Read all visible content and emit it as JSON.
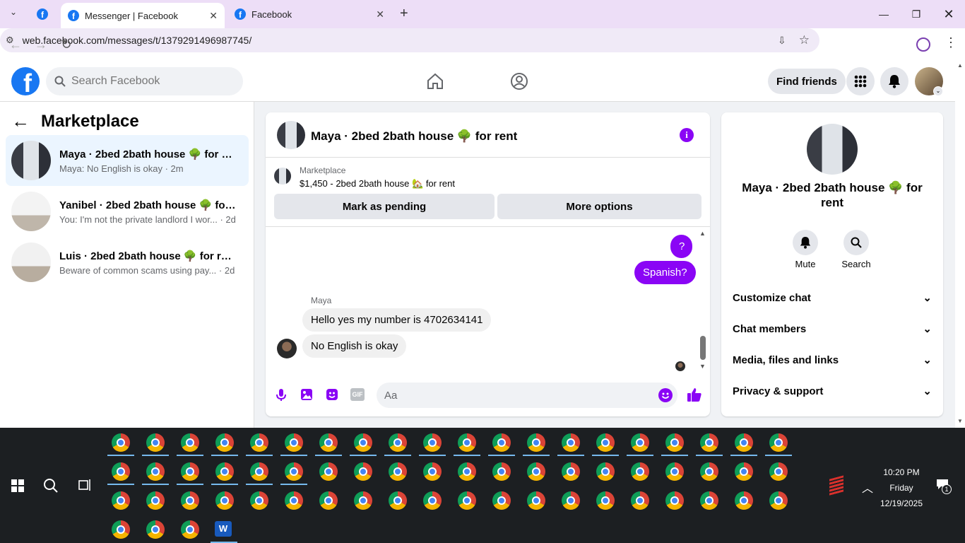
{
  "browser": {
    "tabs": [
      {
        "title": "Messenger | Facebook",
        "active": true
      },
      {
        "title": "Facebook",
        "active": false
      }
    ],
    "url": "web.facebook.com/messages/t/1379291496987745/"
  },
  "fb": {
    "search_placeholder": "Search Facebook",
    "find_friends": "Find friends"
  },
  "sidebar": {
    "title": "Marketplace",
    "conversations": [
      {
        "name": "Maya · 2bed 2bath house 🌳 for re...",
        "preview": "Maya: No English is okay · 2m"
      },
      {
        "name": "Yanibel · 2bed 2bath house 🌳 for ...",
        "preview": "You: I'm not the private landlord I wor... · 2d"
      },
      {
        "name": "Luis · 2bed 2bath house 🌳 for rent",
        "preview": "Beware of common scams using pay... · 2d"
      }
    ]
  },
  "chat": {
    "title": "Maya · 2bed 2bath house 🌳 for rent",
    "listing_label": "Marketplace",
    "listing_text": "$1,450 - 2bed 2bath house 🏡 for rent",
    "mark_pending": "Mark as pending",
    "more_options": "More options",
    "messages_out": [
      "?",
      "Spanish?"
    ],
    "sender": "Maya",
    "messages_in": [
      "Hello yes my number is 4702634141",
      "No English is okay"
    ],
    "input_placeholder": "Aa"
  },
  "info_panel": {
    "name": "Maya · 2bed 2bath house 🌳 for rent",
    "mute": "Mute",
    "search": "Search",
    "sections": [
      "Customize chat",
      "Chat members",
      "Media, files and links",
      "Privacy & support"
    ]
  },
  "taskbar": {
    "time": "10:20 PM",
    "day": "Friday",
    "date": "12/19/2025",
    "notif_count": "1"
  },
  "colors": {
    "fb_blue": "#1877f2",
    "messenger_purple": "#8a05f5"
  }
}
